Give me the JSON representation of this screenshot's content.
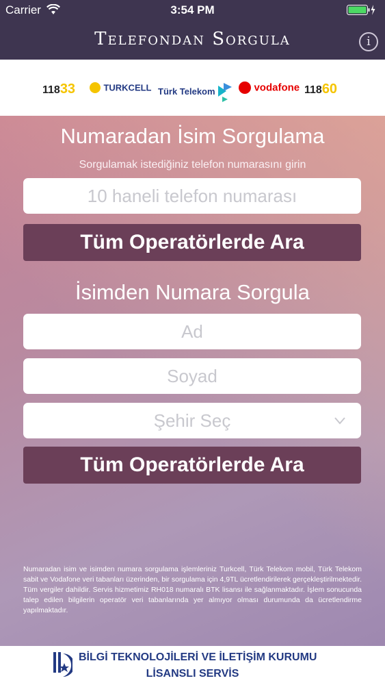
{
  "status_bar": {
    "carrier": "Carrier",
    "time": "3:54 PM",
    "icons": [
      "wifi-icon",
      "battery-icon",
      "charging-bolt-icon"
    ]
  },
  "header": {
    "title": "Telefondan Sorgula",
    "info_icon": "info-icon",
    "info_glyph": "i"
  },
  "operators": {
    "logo_118_33": {
      "prefix": "118",
      "suffix": "33"
    },
    "turkcell": "TURKCELL",
    "turk_telekom": "Türk Telekom",
    "vodafone": "vodafone",
    "logo_118_60": {
      "prefix": "118",
      "suffix": "60"
    }
  },
  "number_search": {
    "title": "Numaradan İsim Sorgulama",
    "subtitle": "Sorgulamak istediğiniz telefon numarasını girin",
    "phone_placeholder": "10 haneli telefon numarası",
    "button_label": "Tüm Operatörlerde Ara"
  },
  "name_search": {
    "title": "İsimden Numara Sorgula",
    "first_name_placeholder": "Ad",
    "last_name_placeholder": "Soyad",
    "city_select_label": "Şehir Seç",
    "chevron_icon": "chevron-down-icon",
    "button_label": "Tüm Operatörlerde Ara"
  },
  "disclaimer": "Numaradan isim ve isimden numara sorgulama işlemleriniz Turkcell, Türk Telekom mobil, Türk Telekom sabit ve Vodafone veri tabanları üzerinden, bir sorgulama için 4,9TL ücretlendirilerek gerçekleştirilmektedir. Tüm vergiler dahildir. Servis hizmetimiz RH018 numaralı BTK lisansı ile sağlanmaktadır. İşlem sonucunda talep edilen bilgilerin operatör veri tabanlarında yer almıyor olması durumunda da ücretlendirme yapılmaktadır.",
  "footer": {
    "line1": "BİLGİ TEKNOLOJİLERİ VE İLETİŞİM KURUMU",
    "line2": "LİSANSLI SERVİS"
  },
  "colors": {
    "header_bg": "#3e3550",
    "button_bg": "#6b3f58",
    "accent_yellow": "#f5c400",
    "vodafone_red": "#e60000",
    "footer_blue": "#233a83"
  }
}
